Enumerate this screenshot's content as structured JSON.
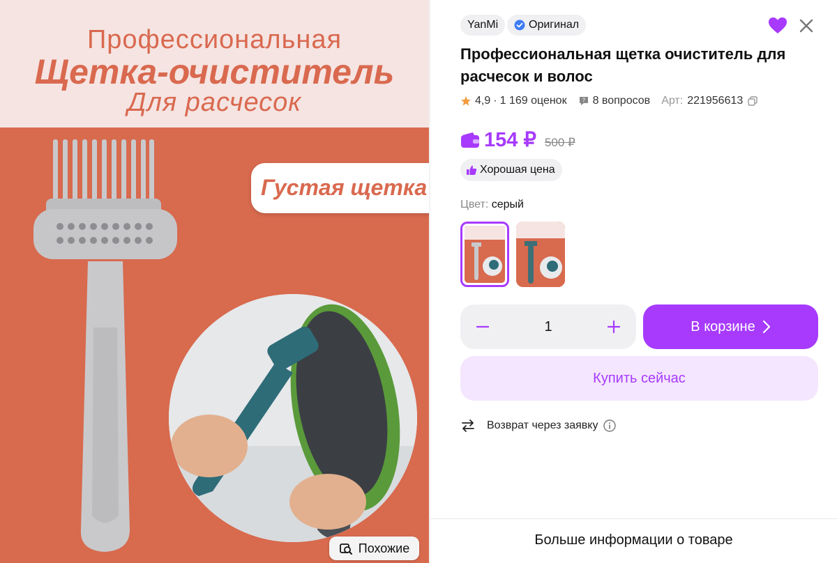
{
  "gallery": {
    "banner_line1": "Профессиональная",
    "banner_line2": "Щетка-очиститель",
    "banner_line3": "Для расчесок",
    "badge": "Густая щетка",
    "similar_label": "Похожие"
  },
  "product": {
    "brand": "YanMi",
    "original_label": "Оригинал",
    "title": "Профессиональная щетка очиститель для расчесок и волос",
    "rating": "4,9",
    "reviews": "1 169 оценок",
    "questions": "8 вопросов",
    "article_label": "Арт:",
    "article": "221956613",
    "price": "154 ₽",
    "old_price": "500 ₽",
    "good_price_label": "Хорошая цена",
    "color_label": "Цвет:",
    "color_value": "серый",
    "quantity": "1",
    "cart_label": "В корзине",
    "buy_now_label": "Купить сейчас",
    "return_label": "Возврат через заявку",
    "more_info_label": "Больше информации о товаре"
  },
  "colors": {
    "accent": "#a73afd",
    "accent_light": "#f4e6fe",
    "banner": "#d86a4e"
  }
}
